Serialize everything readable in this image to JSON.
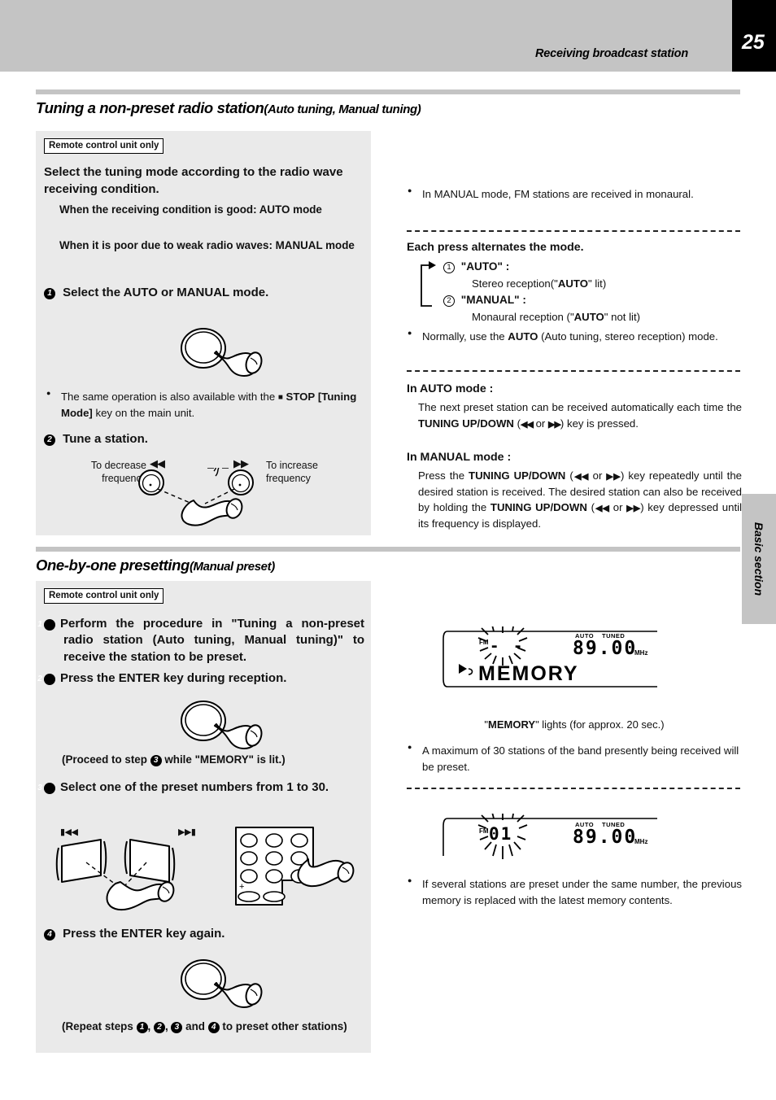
{
  "header": {
    "title": "Receiving broadcast station",
    "page_number": "25",
    "side_tab": "Basic section"
  },
  "section1": {
    "heading_main": "Tuning a non-preset radio station",
    "heading_sub": "(Auto tuning, Manual tuning)",
    "badge": "Remote control unit only",
    "lead": "Select the tuning mode according to the radio wave receiving condition.",
    "cond_good": "When the receiving condition is good: AUTO mode",
    "cond_poor": "When it is poor due to weak radio waves: MANUAL mode",
    "step1": "Select the AUTO or MANUAL mode.",
    "note_stop_a": "The same operation is also available with the ",
    "note_stop_stop": "STOP",
    "note_stop_b": "[Tuning Mode]",
    "note_stop_c": " key on the main unit.",
    "step2": "Tune a station.",
    "dec_label_l1": "To decrease",
    "dec_label_l2": "frequency",
    "inc_label_l1": "To increase",
    "inc_label_l2": "frequency",
    "rew_glyph": "◀◀",
    "ffwd_glyph": "▶▶"
  },
  "right1": {
    "manual_note": "In MANUAL mode, FM stations are received in monaural.",
    "alternates_title": "Each press alternates the mode.",
    "mode1_num": "1",
    "mode1_label": "\"AUTO\" :",
    "mode1_desc_a": "Stereo reception(\"",
    "mode1_desc_b": "AUTO",
    "mode1_desc_c": "\" lit)",
    "mode2_num": "2",
    "mode2_label": "\"MANUAL\" :",
    "mode2_desc_a": "Monaural reception (\"",
    "mode2_desc_b": "AUTO",
    "mode2_desc_c": "\"  not lit)",
    "normally_a": "Normally, use the ",
    "normally_b": "AUTO",
    "normally_c": " (Auto tuning, stereo reception) mode.",
    "auto_mode_title": "In AUTO mode :",
    "auto_mode_t1": "The next preset station can be received automatically each time the ",
    "auto_mode_key": "TUNING UP/DOWN",
    "auto_mode_t2": " (",
    "auto_mode_t3": " or ",
    "auto_mode_t4": ") key is pressed.",
    "manual_mode_title": "In MANUAL mode :",
    "manual_mode_t1": "Press the ",
    "manual_mode_t2": ") key repeatedly until the desired station is received. The desired station can also be received by holding the ",
    "manual_mode_t3": ") key depressed until its frequency is displayed."
  },
  "section2": {
    "heading_main": "One-by-one presetting",
    "heading_sub": "(Manual preset)",
    "badge": "Remote control unit only",
    "step1": "Perform the procedure in \"Tuning a non-preset radio station (Auto tuning, Manual tuning)\" to receive the station to be preset.",
    "step2": "Press the ENTER key during reception.",
    "proceed_a": "(Proceed to step ",
    "proceed_b": " while \"MEMORY\" is lit.)",
    "step3": "Select one of the preset numbers from 1 to 30.",
    "step4": "Press the ENTER key again.",
    "repeat_a": "(Repeat steps ",
    "repeat_b": ", ",
    "repeat_c": ", ",
    "repeat_d": " and ",
    "repeat_e": " to preset other stations)",
    "prev_glyph": "⏮",
    "next_glyph": "⏭",
    "keypad_plus": "+"
  },
  "right2": {
    "memory_caption_a": "\"",
    "memory_caption_b": "MEMORY",
    "memory_caption_c": "\" lights (for approx. 20 sec.)",
    "max_stations": "A maximum of 30 stations of the band presently being received will be preset.",
    "replace_note": "If several stations are preset under the same number, the previous memory is replaced with the latest memory contents."
  },
  "lcd1": {
    "fm_label": "FM",
    "preset": "- -",
    "auto_label": "AUTO",
    "tuned_label": "TUNED",
    "frequency": "89.00",
    "unit": "MHz",
    "memory_text": "MEMORY"
  },
  "lcd2": {
    "fm_label": "FM",
    "preset": "01",
    "auto_label": "AUTO",
    "tuned_label": "TUNED",
    "frequency": "89.00",
    "unit": "MHz"
  }
}
